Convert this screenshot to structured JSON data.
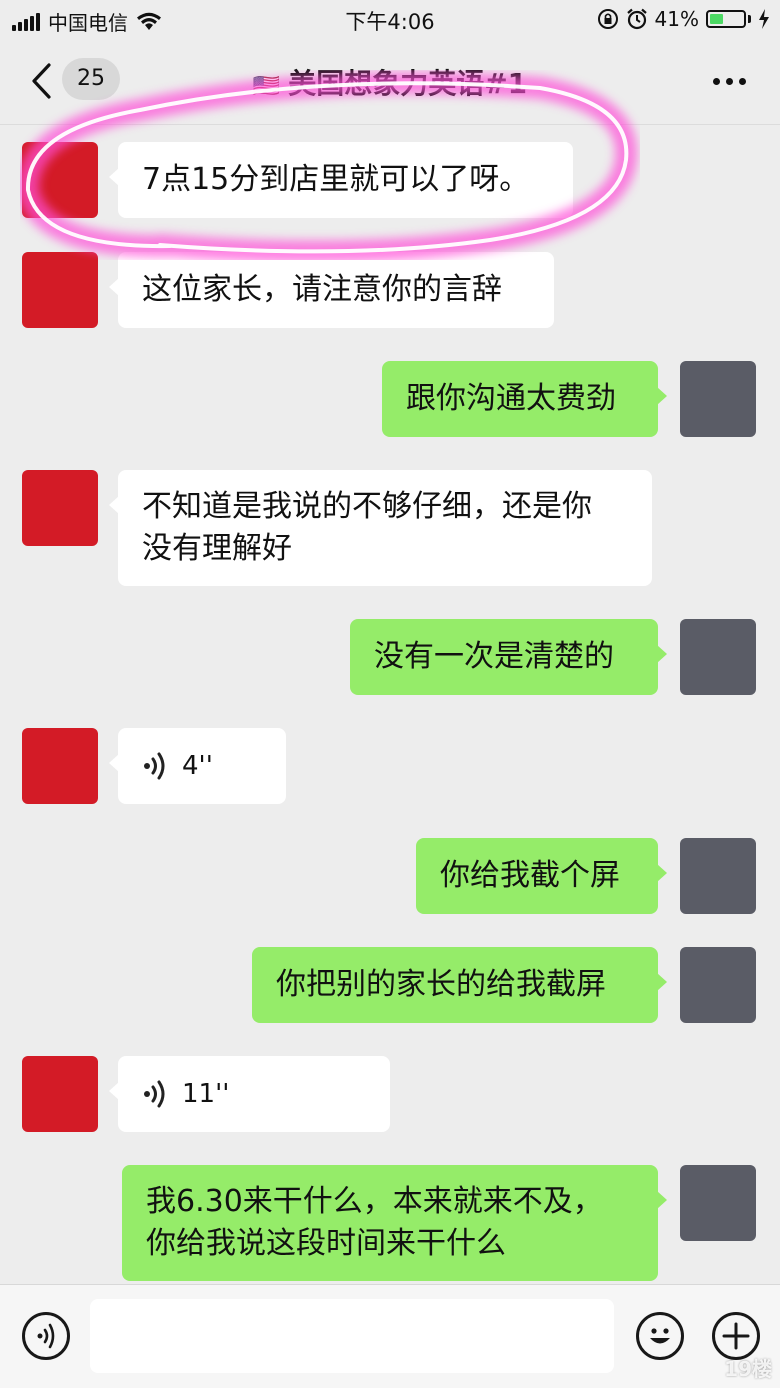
{
  "status_bar": {
    "carrier": "中国电信",
    "time": "下午4:06",
    "battery_percent": "41%",
    "battery_level": 0.41,
    "icons": [
      "signal-icon",
      "wifi-icon",
      "rotation-lock-icon",
      "alarm-icon",
      "battery-icon",
      "charging-icon"
    ]
  },
  "nav": {
    "back_badge": "25",
    "flag": "🇺🇸",
    "title": "美国想象力英语#1",
    "icons": [
      "back-chevron-icon",
      "more-icon"
    ]
  },
  "messages": [
    {
      "side": "left",
      "type": "text",
      "text": "7点15分到店里就可以了呀。"
    },
    {
      "side": "left",
      "type": "text",
      "text": "这位家长，请注意你的言辞"
    },
    {
      "side": "right",
      "type": "text",
      "text": "跟你沟通太费劲"
    },
    {
      "side": "left",
      "type": "text",
      "lines": [
        "不知道是我说的不够仔细，还是你",
        "没有理解好"
      ]
    },
    {
      "side": "right",
      "type": "text",
      "text": "没有一次是清楚的"
    },
    {
      "side": "left",
      "type": "voice",
      "duration": "4''"
    },
    {
      "side": "right",
      "type": "text",
      "text": "你给我截个屏"
    },
    {
      "side": "right",
      "type": "text",
      "text": "你把别的家长的给我截屏"
    },
    {
      "side": "left",
      "type": "voice",
      "duration": "11''"
    },
    {
      "side": "right",
      "type": "text",
      "lines": [
        "我6.30来干什么，本来就来不及，",
        "你给我说这段时间来干什么"
      ]
    }
  ],
  "input_bar": {
    "placeholder": "",
    "icons": [
      "voice-input-icon",
      "emoji-icon",
      "add-icon"
    ]
  },
  "watermark": "19楼",
  "colors": {
    "background": "#ededed",
    "green_bubble": "#95ec69",
    "white_bubble": "#ffffff",
    "highlight": "#ff4fd8"
  }
}
